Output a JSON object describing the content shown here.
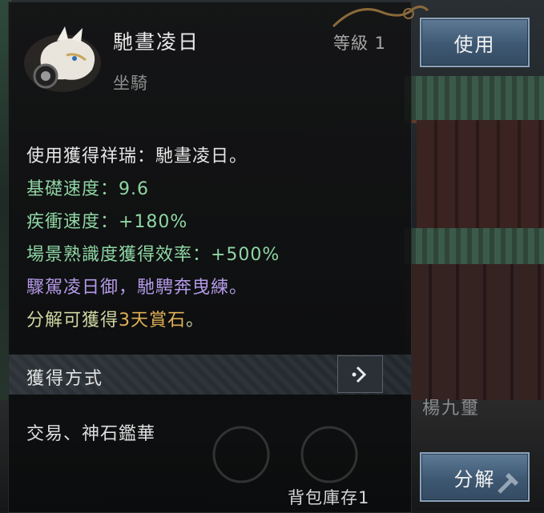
{
  "item": {
    "name": "馳晝凌日",
    "level": "等級 1",
    "type": "坐騎"
  },
  "description": {
    "line1": "使用獲得祥瑞：馳晝凌日。",
    "line2": "基礎速度：9.6",
    "line3": "疾衝速度：+180%",
    "line4": "場景熟識度獲得效率：+500%",
    "line5": "驟駕凌日御，馳騁奔曳練。",
    "line6_prefix": "分解可獲得",
    "line6_highlight": "3天賞石",
    "line6_suffix": "。"
  },
  "acquire": {
    "title": "獲得方式",
    "content": "交易、神石鑑華"
  },
  "stock_text": "背包庫存1",
  "buttons": {
    "use": "使用",
    "decompose": "分解"
  },
  "npc_name": "楊九璽",
  "colors": {
    "green": "#8fd6a4",
    "purple": "#b49ae8",
    "gold": "#e0b054",
    "button": "#4a6580"
  },
  "icons": [
    "mount-item-icon",
    "arrow-right-icon",
    "hammer-icon"
  ]
}
